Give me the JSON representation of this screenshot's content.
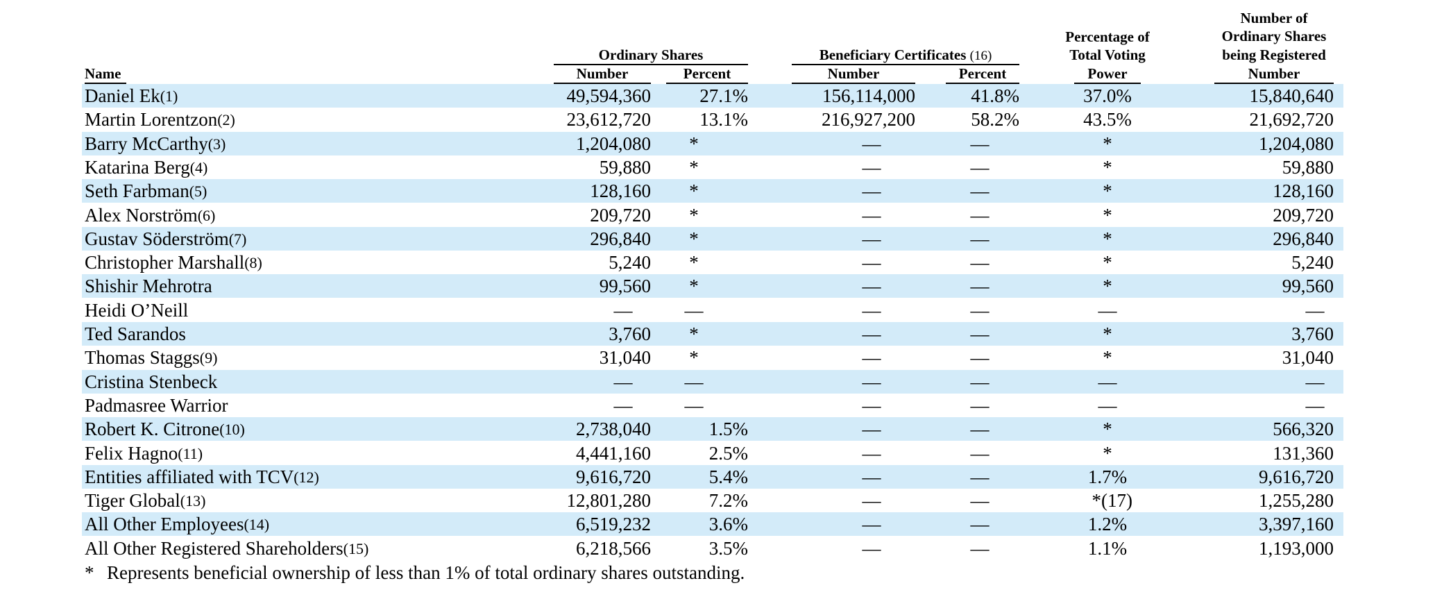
{
  "header": {
    "name": "Name",
    "ordinary_shares": "Ordinary Shares",
    "beneficiary_certificates": "Beneficiary Certificates",
    "beneficiary_fn": "(16)",
    "number": "Number",
    "percent": "Percent",
    "voting_power": [
      "Percentage of",
      "Total Voting",
      "Power"
    ],
    "registered": [
      "Number of",
      "Ordinary Shares",
      "being Registered",
      "Number"
    ]
  },
  "rows": [
    {
      "name": "Daniel Ek",
      "fn": "(1)",
      "os_num": "49,594,360",
      "os_pct": "27.1%",
      "bc_num": "156,114,000",
      "bc_pct": "41.8%",
      "vote": "37.0%",
      "reg": "15,840,640"
    },
    {
      "name": "Martin Lorentzon",
      "fn": "(2)",
      "os_num": "23,612,720",
      "os_pct": "13.1%",
      "bc_num": "216,927,200",
      "bc_pct": "58.2%",
      "vote": "43.5%",
      "reg": "21,692,720"
    },
    {
      "name": "Barry McCarthy",
      "fn": "(3)",
      "os_num": "1,204,080",
      "os_pct": "*",
      "bc_num": "—",
      "bc_pct": "—",
      "vote": "*",
      "reg": "1,204,080"
    },
    {
      "name": "Katarina Berg",
      "fn": "(4)",
      "os_num": "59,880",
      "os_pct": "*",
      "bc_num": "—",
      "bc_pct": "—",
      "vote": "*",
      "reg": "59,880"
    },
    {
      "name": "Seth Farbman",
      "fn": "(5)",
      "os_num": "128,160",
      "os_pct": "*",
      "bc_num": "—",
      "bc_pct": "—",
      "vote": "*",
      "reg": "128,160"
    },
    {
      "name": "Alex Norström",
      "fn": "(6)",
      "os_num": "209,720",
      "os_pct": "*",
      "bc_num": "—",
      "bc_pct": "—",
      "vote": "*",
      "reg": "209,720"
    },
    {
      "name": "Gustav Söderström",
      "fn": "(7)",
      "os_num": "296,840",
      "os_pct": "*",
      "bc_num": "—",
      "bc_pct": "—",
      "vote": "*",
      "reg": "296,840"
    },
    {
      "name": "Christopher Marshall",
      "fn": "(8)",
      "os_num": "5,240",
      "os_pct": "*",
      "bc_num": "—",
      "bc_pct": "—",
      "vote": "*",
      "reg": "5,240"
    },
    {
      "name": "Shishir Mehrotra",
      "fn": "",
      "os_num": "99,560",
      "os_pct": "*",
      "bc_num": "—",
      "bc_pct": "—",
      "vote": "*",
      "reg": "99,560"
    },
    {
      "name": "Heidi O’Neill",
      "fn": "",
      "os_num": "—",
      "os_pct": "—",
      "bc_num": "—",
      "bc_pct": "—",
      "vote": "—",
      "reg": "—"
    },
    {
      "name": "Ted Sarandos",
      "fn": "",
      "os_num": "3,760",
      "os_pct": "*",
      "bc_num": "—",
      "bc_pct": "—",
      "vote": "*",
      "reg": "3,760"
    },
    {
      "name": "Thomas Staggs",
      "fn": "(9)",
      "os_num": "31,040",
      "os_pct": "*",
      "bc_num": "—",
      "bc_pct": "—",
      "vote": "*",
      "reg": "31,040"
    },
    {
      "name": "Cristina Stenbeck",
      "fn": "",
      "os_num": "—",
      "os_pct": "—",
      "bc_num": "—",
      "bc_pct": "—",
      "vote": "—",
      "reg": "—"
    },
    {
      "name": "Padmasree Warrior",
      "fn": "",
      "os_num": "—",
      "os_pct": "—",
      "bc_num": "—",
      "bc_pct": "—",
      "vote": "—",
      "reg": "—"
    },
    {
      "name": "Robert K. Citrone",
      "fn": "(10)",
      "os_num": "2,738,040",
      "os_pct": "1.5%",
      "bc_num": "—",
      "bc_pct": "—",
      "vote": "*",
      "reg": "566,320"
    },
    {
      "name": "Felix Hagno",
      "fn": "(11)",
      "os_num": "4,441,160",
      "os_pct": "2.5%",
      "bc_num": "—",
      "bc_pct": "—",
      "vote": "*",
      "reg": "131,360"
    },
    {
      "name": "Entities affiliated with TCV",
      "fn": "(12)",
      "os_num": "9,616,720",
      "os_pct": "5.4%",
      "bc_num": "—",
      "bc_pct": "—",
      "vote": "1.7%",
      "reg": "9,616,720"
    },
    {
      "name": "Tiger Global",
      "fn": "(13)",
      "os_num": "12,801,280",
      "os_pct": "7.2%",
      "bc_num": "—",
      "bc_pct": "—",
      "vote": "*(17)",
      "reg": "1,255,280"
    },
    {
      "name": "All Other Employees",
      "fn": "(14)",
      "os_num": "6,519,232",
      "os_pct": "3.6%",
      "bc_num": "—",
      "bc_pct": "—",
      "vote": "1.2%",
      "reg": "3,397,160"
    },
    {
      "name": "All Other Registered Shareholders",
      "fn": "(15)",
      "os_num": "6,218,566",
      "os_pct": "3.5%",
      "bc_num": "—",
      "bc_pct": "—",
      "vote": "1.1%",
      "reg": "1,193,000"
    }
  ],
  "footnote": {
    "symbol": "*",
    "text": "Represents beneficial ownership of less than 1% of total ordinary shares outstanding."
  },
  "colors": {
    "row_shade": "#d3ebf9",
    "text": "#000000"
  }
}
